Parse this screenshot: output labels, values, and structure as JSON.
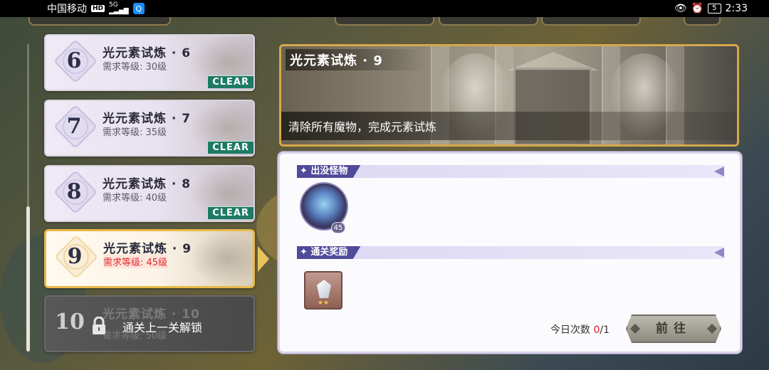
{
  "status_bar": {
    "carrier": "中国移动",
    "hd": "HD",
    "network": "5G",
    "app_badge": "Q",
    "battery": "5",
    "time": "2:33"
  },
  "levels": [
    {
      "num": "6",
      "title": "光元素试炼 · 6",
      "req": "需求等级: 30级",
      "badge": "CLEAR"
    },
    {
      "num": "7",
      "title": "光元素试炼 · 7",
      "req": "需求等级: 35级",
      "badge": "CLEAR"
    },
    {
      "num": "8",
      "title": "光元素试炼 · 8",
      "req": "需求等级: 40级",
      "badge": "CLEAR"
    },
    {
      "num": "9",
      "title": "光元素试炼 · 9",
      "req": "需求等级: 45级"
    },
    {
      "num": "10",
      "title": "光元素试炼 · 10",
      "req": "需求等级: 50级",
      "lock_text": "通关上一关解锁"
    }
  ],
  "banner": {
    "title": "光元素试炼 · 9",
    "description": "清除所有魔物，完成元素试炼"
  },
  "panel": {
    "monsters_label": "出没怪物",
    "monster_level": "45",
    "rewards_label": "通关奖励",
    "count_label": "今日次数",
    "count_current": "0",
    "count_total": "/1",
    "go_label": "前往"
  },
  "colors": {
    "clear_badge": "#1d7b63",
    "active_border": "#e9b94a",
    "section_label": "#504a9a"
  }
}
